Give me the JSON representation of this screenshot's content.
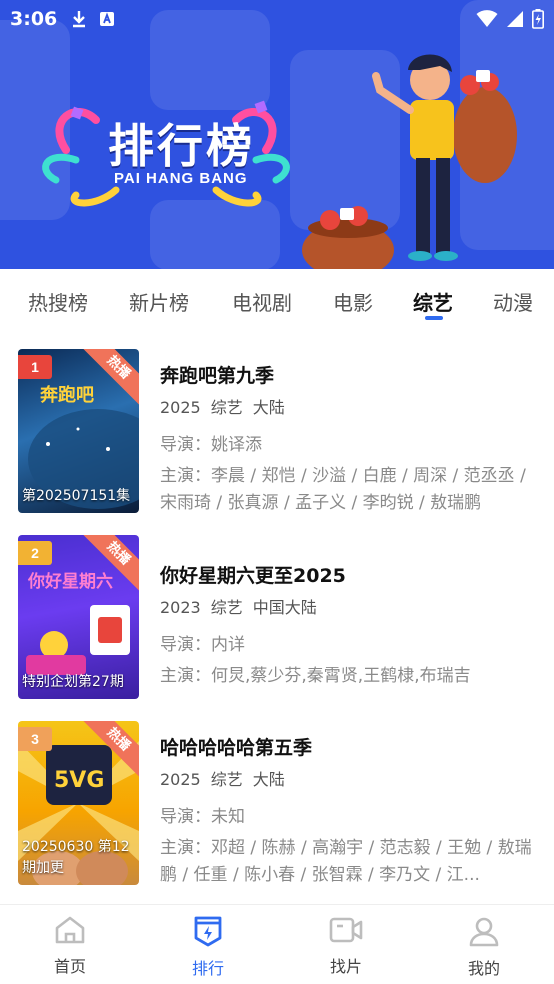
{
  "status_bar": {
    "time": "3:06"
  },
  "banner": {
    "title": "排行榜",
    "subtitle": "PAI HANG BANG"
  },
  "tabs": [
    {
      "label": "热搜榜",
      "active": false
    },
    {
      "label": "新片榜",
      "active": false
    },
    {
      "label": "电视剧",
      "active": false
    },
    {
      "label": "电影",
      "active": false
    },
    {
      "label": "综艺",
      "active": true
    },
    {
      "label": "动漫",
      "active": false
    }
  ],
  "items": [
    {
      "rank": "1",
      "hot": "热播",
      "episode": "第202507151集",
      "title": "奔跑吧第九季",
      "year": "2025",
      "genre": "综艺",
      "region": "大陆",
      "director": "导演：姚译添",
      "cast": "主演：李晨 / 郑恺 / 沙溢 / 白鹿 / 周深 / 范丞丞 / 宋雨琦 / 张真源 / 孟子义 / 李昀锐 / 敖瑞鹏",
      "rank_color": "#e8453c"
    },
    {
      "rank": "2",
      "hot": "热播",
      "episode": "特别企划第27期",
      "title": "你好星期六更至2025",
      "year": "2023",
      "genre": "综艺",
      "region": "中国大陆",
      "director": "导演：内详",
      "cast": "主演：何炅,蔡少芬,秦霄贤,王鹤棣,布瑞吉",
      "rank_color": "#f2b233"
    },
    {
      "rank": "3",
      "hot": "热播",
      "episode": "20250630 第12期加更",
      "title": "哈哈哈哈哈第五季",
      "year": "2025",
      "genre": "综艺",
      "region": "大陆",
      "director": "导演：未知",
      "cast": "主演：邓超 / 陈赫 / 高瀚宇 / 范志毅 / 王勉 / 敖瑞鹏 / 任重 / 陈小春 / 张智霖 / 李乃文 / 江...",
      "rank_color": "#f0a15a"
    }
  ],
  "bottom_nav": [
    {
      "label": "首页",
      "icon": "home-icon",
      "active": false
    },
    {
      "label": "排行",
      "icon": "ranking-icon",
      "active": true
    },
    {
      "label": "找片",
      "icon": "video-camera-icon",
      "active": false
    },
    {
      "label": "我的",
      "icon": "profile-icon",
      "active": false
    }
  ],
  "colors": {
    "accent": "#2f6bf0",
    "banner_bg": "#2f52e0"
  }
}
